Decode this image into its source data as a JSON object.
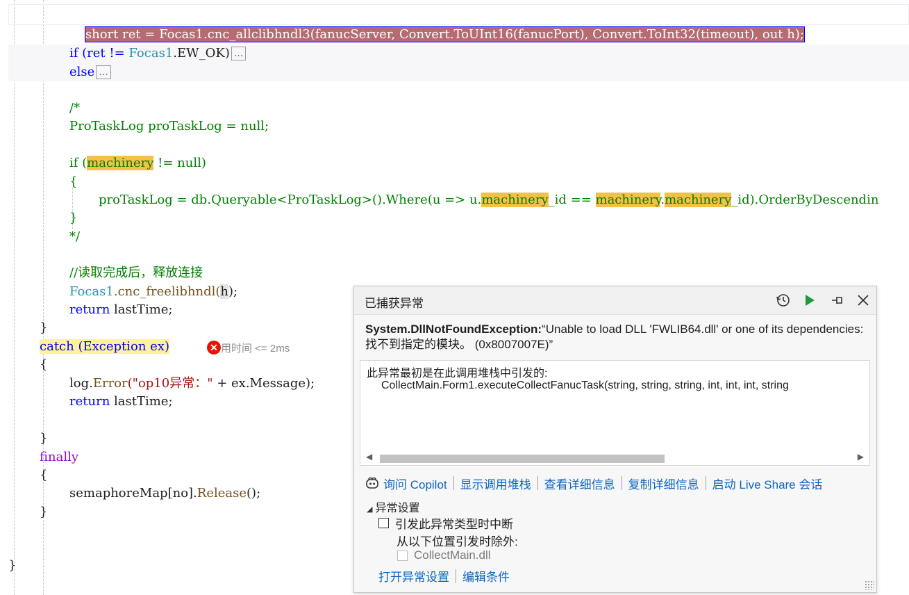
{
  "code": {
    "bp_stmt": "short ret = Focas1.cnc_allclibhndl3(fanucServer, Convert.ToUInt16(fanucPort), Convert.ToInt32(timeout), out h);",
    "if_ret_a": "if (ret != ",
    "focas1": "Focas1",
    "ew_ok": ".EW_OK)",
    "ellipsis": "...",
    "else_kw": "else",
    "comment_open": "/*",
    "protasklog_decl": "ProTaskLog proTaskLog = null;",
    "if_kw": "if (",
    "machinery": "machinery",
    "not_null": " != null)",
    "brace_open": "{",
    "brace_close": "}",
    "assign_a": "proTaskLog = db.",
    "queryable": "Queryable",
    "generic_arg": "<ProTaskLog>().",
    "where": "Where",
    "lambda_a": "(u => u.",
    "id_eq": "_id == ",
    "dot": ".",
    "id_end": "_id).",
    "orderby": "OrderByDescendin",
    "comment_close": "*/",
    "comment_cn": "//读取完成后，释放连接",
    "freelib_a": ".cnc_freelibhndl(",
    "h": "h",
    "freelib_b": ");",
    "return_kw": "return",
    "last_time": " lastTime;",
    "catch_line": "catch (Exception ex)",
    "log": "log.",
    "error_m": "Error",
    "str_lit": "(\"op10异常：\"",
    "plus_msg": " + ex.Message);",
    "finally_kw": "finally",
    "sem_a": "semaphoreMap[no].",
    "release": "Release",
    "sem_b": "();",
    "elapsed": "用时间 <= 2ms"
  },
  "popup": {
    "title": "已捕获异常",
    "exception_type": "System.DllNotFoundException:",
    "exception_message": "“Unable to load DLL 'FWLIB64.dll' or one of its dependencies: 找不到指定的模块。 (0x8007007E)”",
    "stack_label": "此异常最初是在此调用堆栈中引发的:",
    "stack_frame": "CollectMain.Form1.executeCollectFanucTask(string, string, string, int, int, int, string",
    "actions": {
      "ask_copilot": "询问 Copilot",
      "show_call_stack": "显示调用堆栈",
      "view_details": "查看详细信息",
      "copy_details": "复制详细信息",
      "live_share": "启动 Live Share 会话"
    },
    "settings": {
      "header": "异常设置",
      "break_when_thrown": "引发此异常类型时中断",
      "except_from": "从以下位置引发时除外:",
      "module": "CollectMain.dll",
      "break_checked": false,
      "module_checked": false
    },
    "bottom_links": {
      "open_settings": "打开异常设置",
      "edit_conditions": "编辑条件"
    }
  },
  "colors": {
    "breakpoint_line": "#b66b72",
    "highlight": "#f5c04a",
    "error": "#e51400",
    "link": "#0e65c0"
  }
}
